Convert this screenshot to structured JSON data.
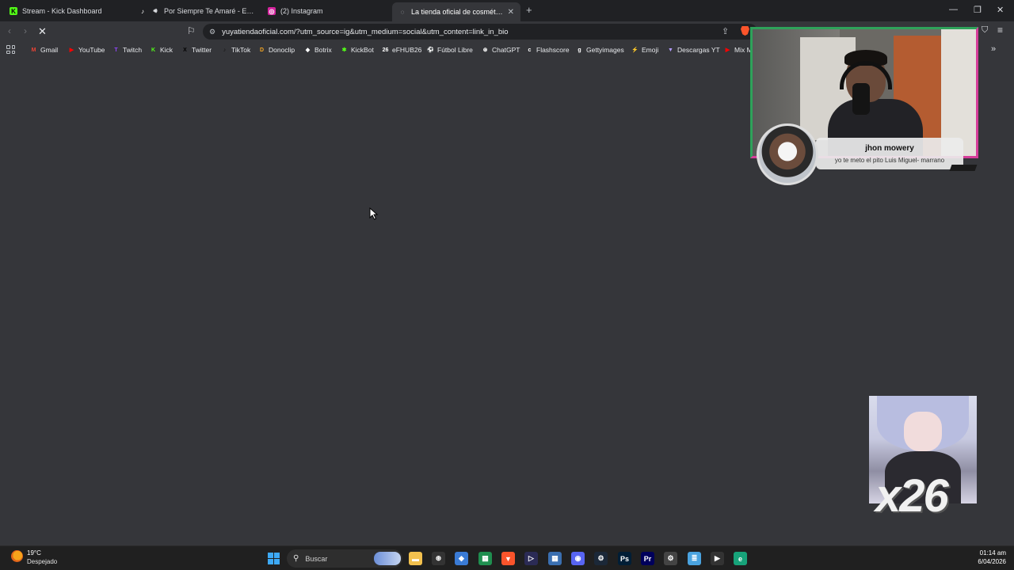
{
  "browser": {
    "tabs": [
      {
        "label": "Stream - Kick Dashboard",
        "icon": "kick-icon",
        "color": "#53fc18",
        "glyph": "K"
      },
      {
        "label": "Por Siempre Te Amaré - Evento M",
        "icon": "tiktok-icon",
        "color": "#111111",
        "glyph": "♪"
      },
      {
        "label": "(2) Instagram",
        "icon": "instagram-icon",
        "color": "#d6249f",
        "glyph": "◎"
      },
      {
        "label": "La tienda oficial de cosméticos Y",
        "icon": "shop-icon",
        "color": "#e8eaed",
        "glyph": "⚲"
      }
    ],
    "new_tab": "+",
    "window_controls": {
      "minimize": "—",
      "restore": "❐",
      "close": "✕"
    },
    "url": "yuyatiendaoficial.com/?utm_source=ig&utm_medium=social&utm_content=link_in_bio",
    "bookmarks": [
      {
        "label": "Gmail",
        "icon": "gmail-icon",
        "color": "#ea4335",
        "glyph": "M"
      },
      {
        "label": "YouTube",
        "icon": "youtube-icon",
        "color": "#ff0000",
        "glyph": "▶"
      },
      {
        "label": "Twitch",
        "icon": "twitch-icon",
        "color": "#9146ff",
        "glyph": "T"
      },
      {
        "label": "Kick",
        "icon": "kick-icon",
        "color": "#53fc18",
        "glyph": "K"
      },
      {
        "label": "Twitter",
        "icon": "x-icon",
        "color": "#000000",
        "glyph": "X"
      },
      {
        "label": "TikTok",
        "icon": "tiktok-icon",
        "color": "#111111",
        "glyph": "♪"
      },
      {
        "label": "Donoclip",
        "icon": "donoclip-icon",
        "color": "#f5a623",
        "glyph": "D"
      },
      {
        "label": "Botrix",
        "icon": "botrix-icon",
        "color": "#ffffff",
        "glyph": "◆"
      },
      {
        "label": "KickBot",
        "icon": "kickbot-icon",
        "color": "#53fc18",
        "glyph": "✱"
      },
      {
        "label": "eFHUB26",
        "icon": "efhub-icon",
        "color": "#ffffff",
        "glyph": "26"
      },
      {
        "label": "Fútbol Libre",
        "icon": "futbol-icon",
        "color": "#ffffff",
        "glyph": "⚽"
      },
      {
        "label": "ChatGPT",
        "icon": "chatgpt-icon",
        "color": "#ffffff",
        "glyph": "⊛"
      },
      {
        "label": "Flashscore",
        "icon": "flashscore-icon",
        "color": "#ffffff",
        "glyph": "c"
      },
      {
        "label": "Gettyimages",
        "icon": "getty-icon",
        "color": "#ffffff",
        "glyph": "g"
      },
      {
        "label": "Emoji",
        "icon": "emoji-icon",
        "color": "#ff3355",
        "glyph": "⚡"
      },
      {
        "label": "Descargas YT",
        "icon": "download-icon",
        "color": "#b49cff",
        "glyph": "▼"
      },
      {
        "label": "Mix M",
        "icon": "mix-icon",
        "color": "#ff0000",
        "glyph": "▶"
      }
    ]
  },
  "overlay": {
    "alert_name": "jhon mowery",
    "alert_message": "yo te meto el pito Luis Miguel- marrano",
    "multiplier": "x26"
  },
  "taskbar": {
    "temperature": "19°C",
    "weather": "Despejado",
    "search_label": "Buscar",
    "time": "01:14 am",
    "date": "6/04/2026",
    "apps": [
      {
        "icon": "file-explorer-icon",
        "color": "#f2c14e",
        "glyph": "▬"
      },
      {
        "icon": "chatgpt-icon",
        "color": "#333333",
        "glyph": "⊛"
      },
      {
        "icon": "app-icon",
        "color": "#3a7bd5",
        "glyph": "◆"
      },
      {
        "icon": "spreadsheet-icon",
        "color": "#1f8e4f",
        "glyph": "▦"
      },
      {
        "icon": "brave-icon",
        "color": "#fb542b",
        "glyph": "▼"
      },
      {
        "icon": "media-icon",
        "color": "#2b2b55",
        "glyph": "▷"
      },
      {
        "icon": "calculator-icon",
        "color": "#3a6fb0",
        "glyph": "▦"
      },
      {
        "icon": "discord-icon",
        "color": "#5865f2",
        "glyph": "◉"
      },
      {
        "icon": "steam-icon",
        "color": "#1b2838",
        "glyph": "⚙"
      },
      {
        "icon": "photoshop-icon",
        "color": "#001e36",
        "glyph": "Ps"
      },
      {
        "icon": "premiere-icon",
        "color": "#00005b",
        "glyph": "Pr"
      },
      {
        "icon": "settings-icon",
        "color": "#444444",
        "glyph": "⚙"
      },
      {
        "icon": "notepad-icon",
        "color": "#4aa3df",
        "glyph": "≣"
      },
      {
        "icon": "player-icon",
        "color": "#333333",
        "glyph": "▶"
      },
      {
        "icon": "edge-icon",
        "color": "#17a37a",
        "glyph": "e"
      }
    ]
  }
}
